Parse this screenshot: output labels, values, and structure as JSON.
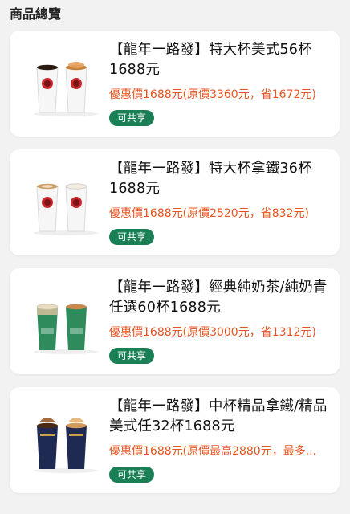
{
  "section": {
    "title": "商品總覽"
  },
  "colors": {
    "accent": "#1a7f55",
    "price": "#e8531f"
  },
  "products": [
    {
      "name": "【龍年一路發】特大杯美式56杯1688元",
      "price_text": "優惠價1688元(原價3360元，省1672元)",
      "badge": "可共享",
      "image_icon": "coffee-cups-white-icon"
    },
    {
      "name": "【龍年一路發】特大杯拿鐵36杯1688元",
      "price_text": "優惠價1688元(原價2520元，省832元)",
      "badge": "可共享",
      "image_icon": "latte-cups-white-icon"
    },
    {
      "name": "【龍年一路發】經典純奶茶/純奶青任選60杯1688元",
      "price_text": "優惠價1688元(原價3000元，省1312元)",
      "badge": "可共享",
      "image_icon": "milk-tea-cups-green-icon"
    },
    {
      "name": "【龍年一路發】中杯精品拿鐵/精品美式任32杯1688元",
      "price_text": "優惠價1688元(原價最高2880元，最多...",
      "badge": "可共享",
      "image_icon": "premium-cups-navy-icon"
    }
  ]
}
